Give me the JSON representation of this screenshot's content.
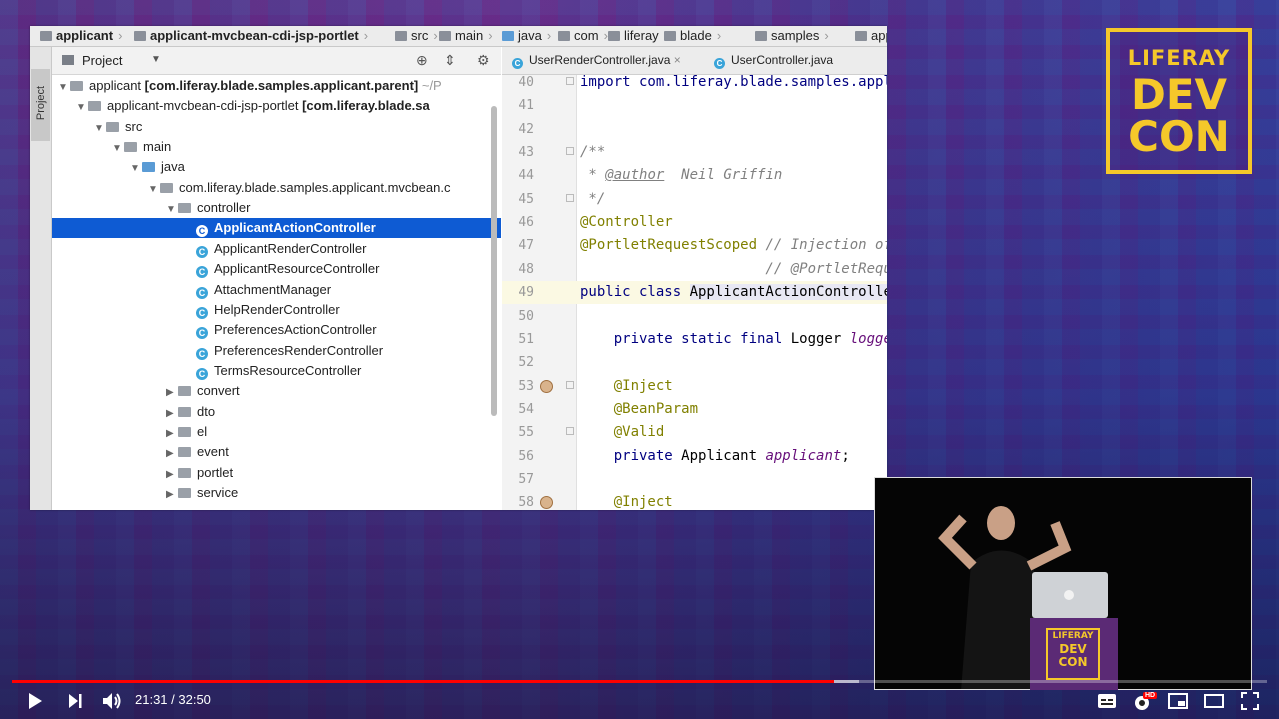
{
  "breadcrumb": [
    "applicant",
    "applicant-mvcbean-cdi-jsp-portlet",
    "src",
    "main",
    "java",
    "com",
    "liferay",
    "blade",
    "samples",
    "applic"
  ],
  "sidebar": {
    "tab_label": "Project"
  },
  "project_panel": {
    "title": "Project",
    "tree": [
      {
        "indent": 0,
        "expanded": true,
        "kind": "module",
        "label": "applicant",
        "bold_suffix": "[com.liferay.blade.samples.applicant.parent]",
        "muted_suffix": "~/P"
      },
      {
        "indent": 1,
        "expanded": true,
        "kind": "module",
        "label": "applicant-mvcbean-cdi-jsp-portlet",
        "bold_suffix": "[com.liferay.blade.sa",
        "muted_suffix": ""
      },
      {
        "indent": 2,
        "expanded": true,
        "kind": "folder",
        "label": "src"
      },
      {
        "indent": 3,
        "expanded": true,
        "kind": "folder",
        "label": "main"
      },
      {
        "indent": 4,
        "expanded": true,
        "kind": "src-folder",
        "label": "java"
      },
      {
        "indent": 5,
        "expanded": true,
        "kind": "folder",
        "label": "com.liferay.blade.samples.applicant.mvcbean.c"
      },
      {
        "indent": 6,
        "expanded": true,
        "kind": "folder",
        "label": "controller"
      },
      {
        "indent": 7,
        "kind": "class",
        "label": "ApplicantActionController",
        "selected": true
      },
      {
        "indent": 7,
        "kind": "class",
        "label": "ApplicantRenderController"
      },
      {
        "indent": 7,
        "kind": "class",
        "label": "ApplicantResourceController"
      },
      {
        "indent": 7,
        "kind": "class",
        "label": "AttachmentManager"
      },
      {
        "indent": 7,
        "kind": "class",
        "label": "HelpRenderController"
      },
      {
        "indent": 7,
        "kind": "class",
        "label": "PreferencesActionController"
      },
      {
        "indent": 7,
        "kind": "class",
        "label": "PreferencesRenderController"
      },
      {
        "indent": 7,
        "kind": "class",
        "label": "TermsResourceController"
      },
      {
        "indent": 6,
        "expanded": false,
        "kind": "folder",
        "label": "convert"
      },
      {
        "indent": 6,
        "expanded": false,
        "kind": "folder",
        "label": "dto"
      },
      {
        "indent": 6,
        "expanded": false,
        "kind": "folder",
        "label": "el"
      },
      {
        "indent": 6,
        "expanded": false,
        "kind": "folder",
        "label": "event"
      },
      {
        "indent": 6,
        "expanded": false,
        "kind": "folder",
        "label": "portlet"
      },
      {
        "indent": 6,
        "expanded": false,
        "kind": "folder",
        "label": "service"
      }
    ]
  },
  "editor": {
    "tabs": [
      {
        "label": "UserRenderController.java",
        "closable": true
      },
      {
        "label": "UserController.java",
        "closable": false
      }
    ],
    "current_line": "49",
    "lines": [
      {
        "num": "40",
        "segments": [
          {
            "t": "import com.liferay.blade.samples.appli",
            "c": "kw"
          }
        ]
      },
      {
        "num": "41",
        "segments": []
      },
      {
        "num": "42",
        "segments": []
      },
      {
        "num": "43",
        "segments": [
          {
            "t": "/**",
            "c": "cm"
          }
        ]
      },
      {
        "num": "44",
        "segments": [
          {
            "t": " * ",
            "c": "cm"
          },
          {
            "t": "@author",
            "c": "jd"
          },
          {
            "t": "  Neil Griffin",
            "c": "cm"
          }
        ]
      },
      {
        "num": "45",
        "segments": [
          {
            "t": " */",
            "c": "cm"
          }
        ]
      },
      {
        "num": "46",
        "segments": [
          {
            "t": "@Controller",
            "c": "ann"
          }
        ]
      },
      {
        "num": "47",
        "segments": [
          {
            "t": "@PortletRequestScoped",
            "c": "ann"
          },
          {
            "t": " // Injection of",
            "c": "cm"
          }
        ]
      },
      {
        "num": "48",
        "segments": [
          {
            "t": "                      // @PortletReque",
            "c": "cm"
          }
        ]
      },
      {
        "num": "49",
        "segments": [
          {
            "t": "public class ",
            "c": "kw"
          },
          {
            "t": "ApplicantActionController",
            "c": "hl"
          }
        ]
      },
      {
        "num": "50",
        "segments": []
      },
      {
        "num": "51",
        "segments": [
          {
            "t": "    private static final ",
            "c": "kw"
          },
          {
            "t": "Logger ",
            "c": ""
          },
          {
            "t": "logger",
            "c": "fld"
          }
        ]
      },
      {
        "num": "52",
        "segments": []
      },
      {
        "num": "53",
        "segments": [
          {
            "t": "    @Inject",
            "c": "ann"
          }
        ],
        "gutter_icon": true
      },
      {
        "num": "54",
        "segments": [
          {
            "t": "    @BeanParam",
            "c": "ann"
          }
        ]
      },
      {
        "num": "55",
        "segments": [
          {
            "t": "    @Valid",
            "c": "ann"
          }
        ]
      },
      {
        "num": "56",
        "segments": [
          {
            "t": "    private ",
            "c": "kw"
          },
          {
            "t": "Applicant ",
            "c": ""
          },
          {
            "t": "applicant",
            "c": "fld"
          },
          {
            "t": ";",
            "c": ""
          }
        ]
      },
      {
        "num": "57",
        "segments": []
      },
      {
        "num": "58",
        "segments": [
          {
            "t": "    @Inject",
            "c": "ann"
          }
        ],
        "gutter_icon": true
      }
    ]
  },
  "logo": {
    "line1": "LIFERAY",
    "line2": "DEV",
    "line3": "CON"
  },
  "pip_podium": {
    "line1": "LIFERAY",
    "line2": "DEV",
    "line3": "CON"
  },
  "player": {
    "current_time": "21:31",
    "duration": "32:50",
    "time_display": "21:31 / 32:50",
    "played_fraction": 0.655,
    "buffered_fraction": 0.675,
    "hd_badge": "HD"
  }
}
